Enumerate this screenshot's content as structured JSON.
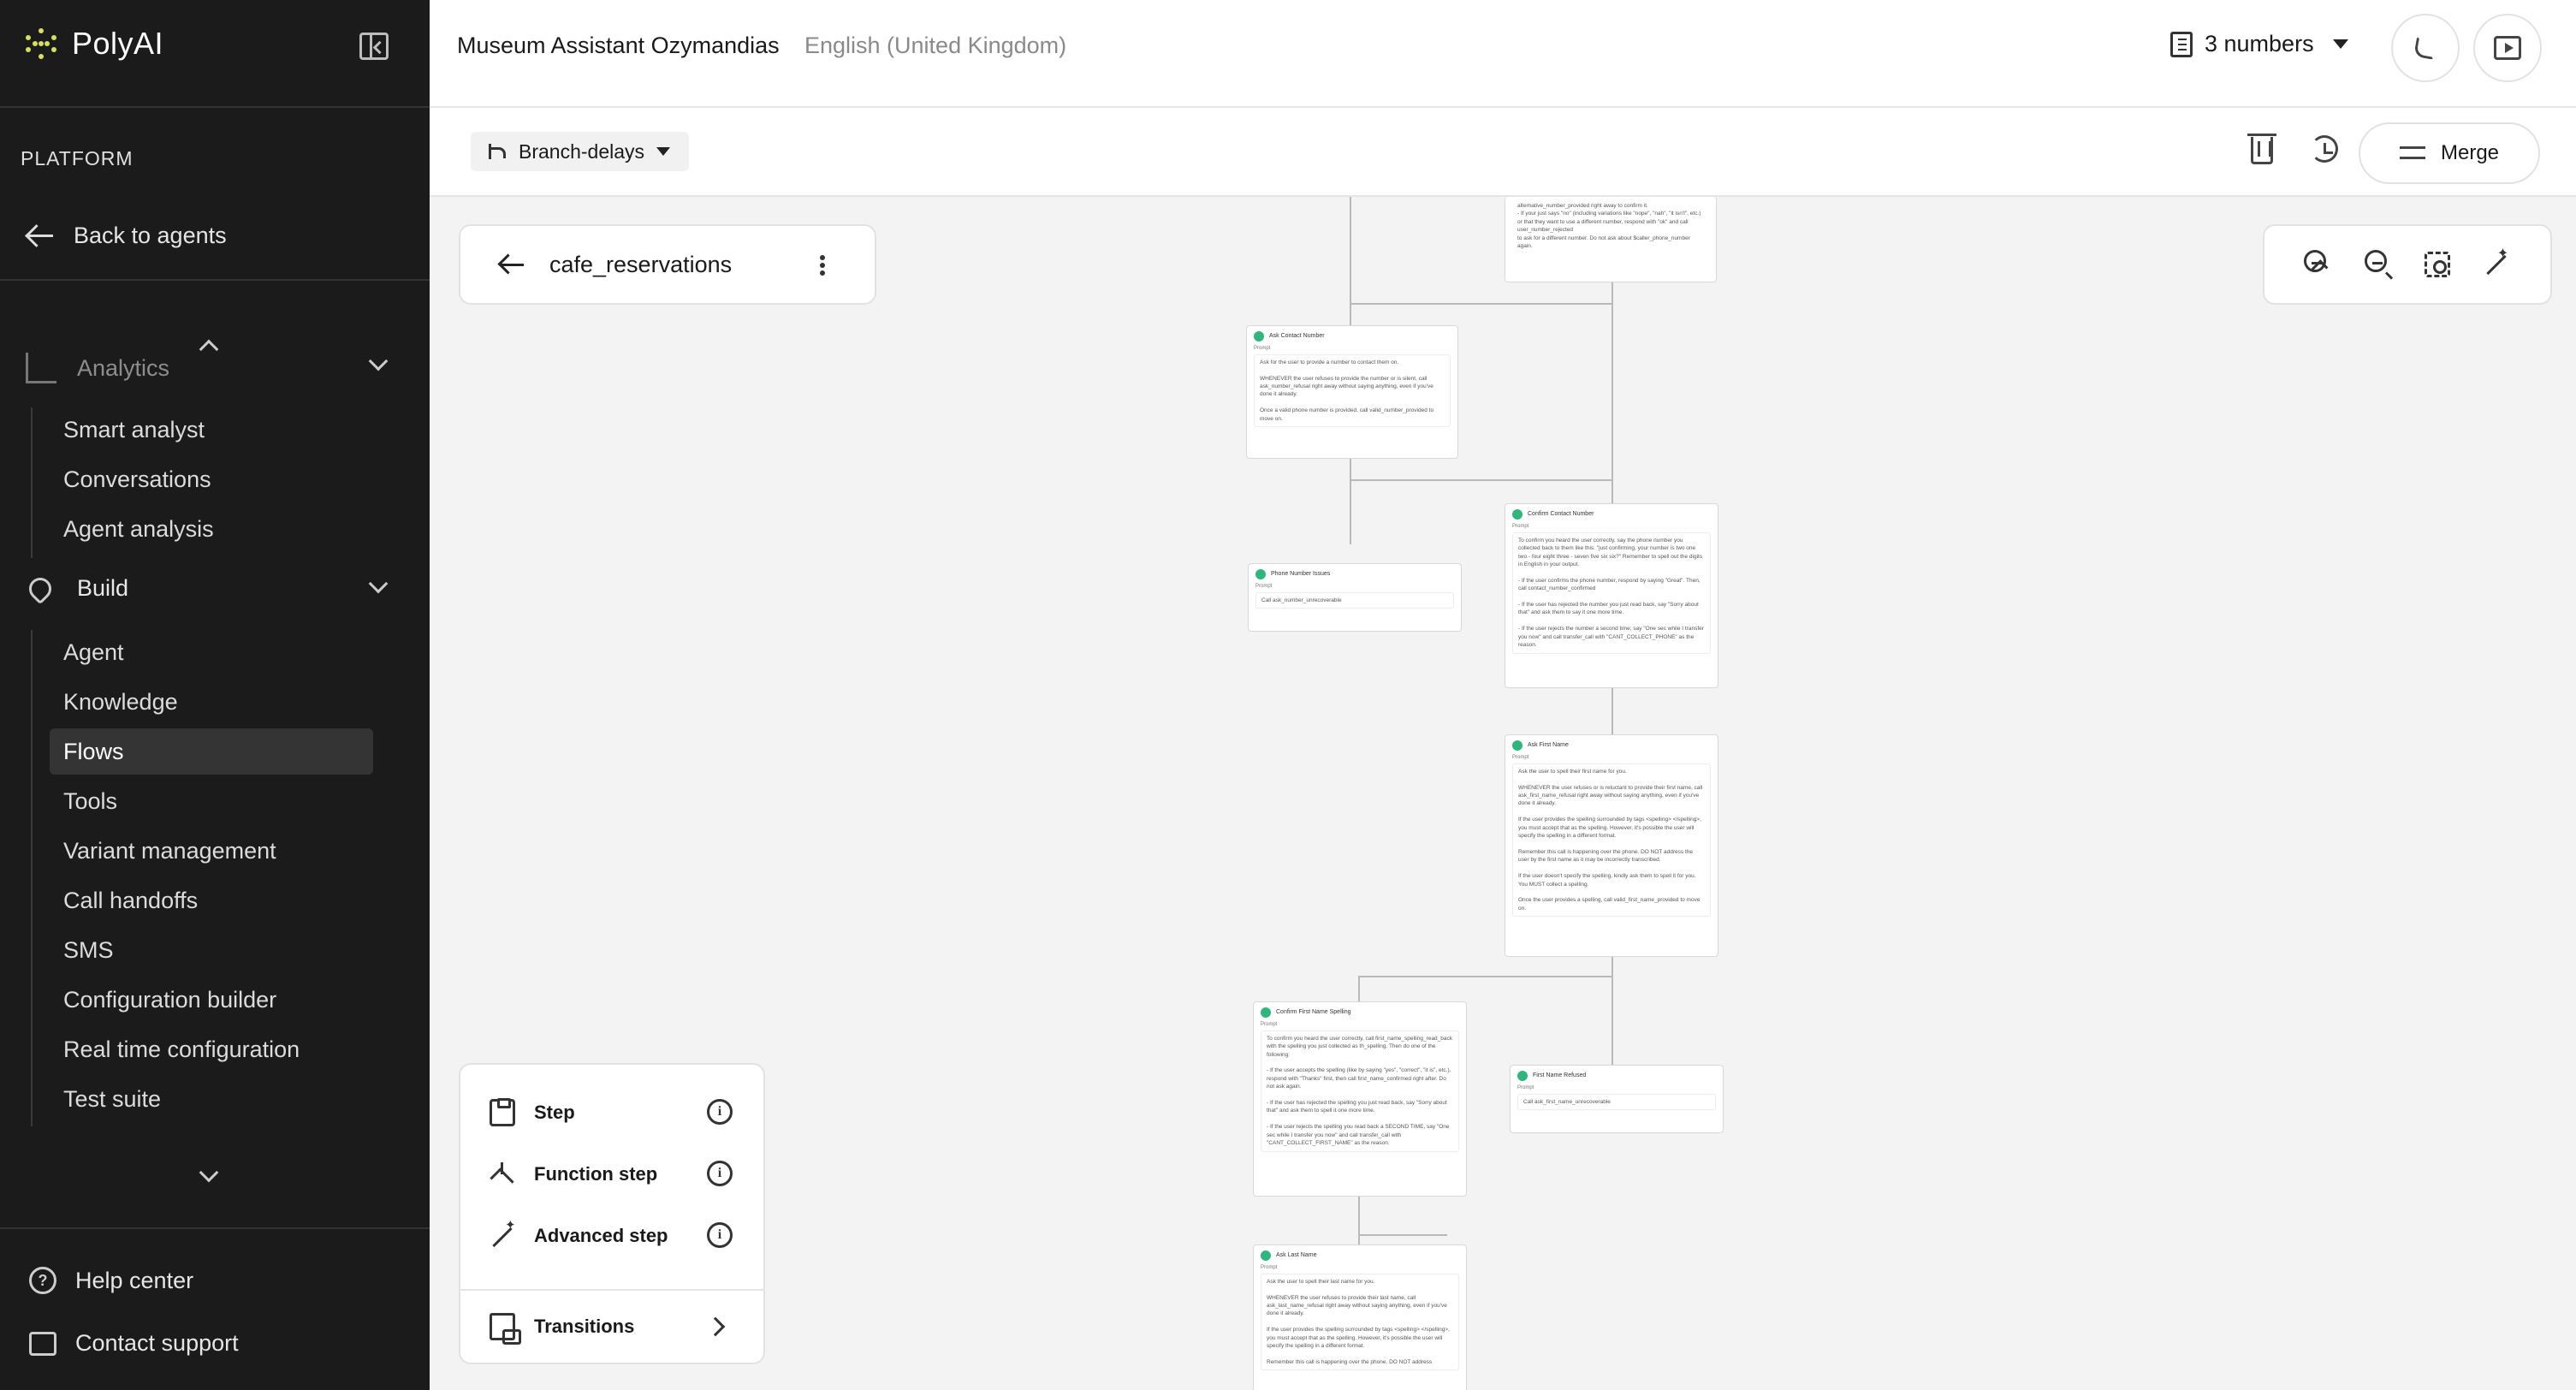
{
  "brand": {
    "name": "PolyAI"
  },
  "sidebar": {
    "section_label": "PLATFORM",
    "back_label": "Back to agents",
    "analytics": {
      "label": "Analytics",
      "items": [
        "Smart analyst",
        "Conversations",
        "Agent analysis"
      ]
    },
    "build": {
      "label": "Build",
      "items": [
        "Agent",
        "Knowledge",
        "Flows",
        "Tools",
        "Variant management",
        "Call handoffs",
        "SMS",
        "Configuration builder",
        "Real time configuration",
        "Test suite"
      ],
      "active": "Flows"
    },
    "footer": {
      "help": "Help center",
      "support": "Contact support"
    }
  },
  "header": {
    "agent_name": "Museum Assistant Ozymandias",
    "language": "English (United Kingdom)",
    "numbers_label": "3 numbers"
  },
  "toolbar": {
    "branch": "Branch-delays",
    "merge_label": "Merge"
  },
  "flow": {
    "name": "cafe_reservations"
  },
  "palette": {
    "step": "Step",
    "function_step": "Function step",
    "advanced_step": "Advanced step",
    "transitions": "Transitions"
  },
  "nodes": {
    "top": {
      "body": "alternative_number_provided  right away to confirm it.\n- If your just says \"no\" (including variations like \"nope\", \"nah\", \"it isn't\", etc.) or that they want to use a different number, respond with \"ok\" and call  user_number_rejected\n to ask for a different number. Do not ask about $caller_phone_number again."
    },
    "ask_contact": {
      "title": "Ask Contact Number",
      "prompt": "Prompt",
      "body": "Ask for the user to provide a number to contact them on.\n\nWHENEVER the user refuses to provide the number or is silent, call  ask_number_refusal  right away without saying anything, even if you've done it already.\n\nOnce a valid phone number is provided, call  valid_number_provided  to move on."
    },
    "phone_issues": {
      "title": "Phone Number Issues",
      "prompt": "Prompt",
      "body": "Call  ask_number_unrecoverable"
    },
    "confirm_contact": {
      "title": "Confirm Contact Number",
      "prompt": "Prompt",
      "body": "To confirm you heard the user correctly, say the phone number you collected back to them like this: \"just confirming, your number is two one two - four eight three - seven five six six?\" Remember to spell out the digits in English in your output.\n\n- If the user confirms the phone number, respond by saying \"Great\". Then, call  contact_number_confirmed\n\n- If the user has rejected the number you just read back, say \"Sorry about that\" and ask them to say it one more time.\n\n- If the user rejects the number a second time, say \"One sec while I transfer you now\" and call  transfer_call  with \"CANT_COLLECT_PHONE\" as the reason."
    },
    "ask_first": {
      "title": "Ask First Name",
      "prompt": "Prompt",
      "body": "Ask the user to spell their first name for you.\n\nWHENEVER the user refuses or is reluctant to provide their first name, call  ask_first_name_refusal  right away without saying anything, even if you've done it already.\n\nIf the user provides the spelling surrounded by tags <spelling> </spelling>, you must accept that as the spelling. However, it's possible the user will specify the spelling in a different format.\n\nRemember this call is happening over the phone. DO NOT address the user by the first name as it may be incorrectly transcribed.\n\nIf the user doesn't specify the spelling, kindly ask them to spell it for you. You MUST collect a spelling.\n\nOnce the user provides a spelling, call  valid_first_name_provided  to move on."
    },
    "confirm_first": {
      "title": "Confirm First Name Spelling",
      "prompt": "Prompt",
      "body": "To confirm you heard the user correctly, call  first_name_spelling_read_back  with the spelling you just collected as th_spelling. Then do one of the following:\n\n- If the user accepts the spelling (like by saying \"yes\", \"correct\", \"it is\", etc.), respond with \"Thanks\" first, then call  first_name_confirmed  right after. Do not ask again.\n\n- If the user has rejected the spelling you just read back, say \"Sorry about that\" and ask them to spell it one more time.\n\n- If the user rejects the spelling you read back a SECOND TIME, say \"One sec while I transfer you now\" and call  transfer_call  with \"CANT_COLLECT_FIRST_NAME\" as the reason."
    },
    "first_refused": {
      "title": "First Name Refused",
      "prompt": "Prompt",
      "body": "Call  ask_first_name_unrecoverable"
    },
    "ask_last": {
      "title": "Ask Last Name",
      "prompt": "Prompt",
      "body": "Ask the user to spell their last name for you.\n\nWHENEVER the user refuses to provide their last name, call  ask_last_name_refusal  right away without saying anything, even if you've done it already.\n\nIf the user provides the spelling surrounded by tags <spelling> </spelling>, you must accept that as the spelling. However, it's possible the user will specify the spelling in a different format.\n\nRemember this call is happening over the phone. DO NOT address"
    }
  },
  "colors": {
    "sidebar_bg": "#1b1b1b",
    "step_dot": "#2eb67d",
    "chip": "#3b6fd6"
  }
}
